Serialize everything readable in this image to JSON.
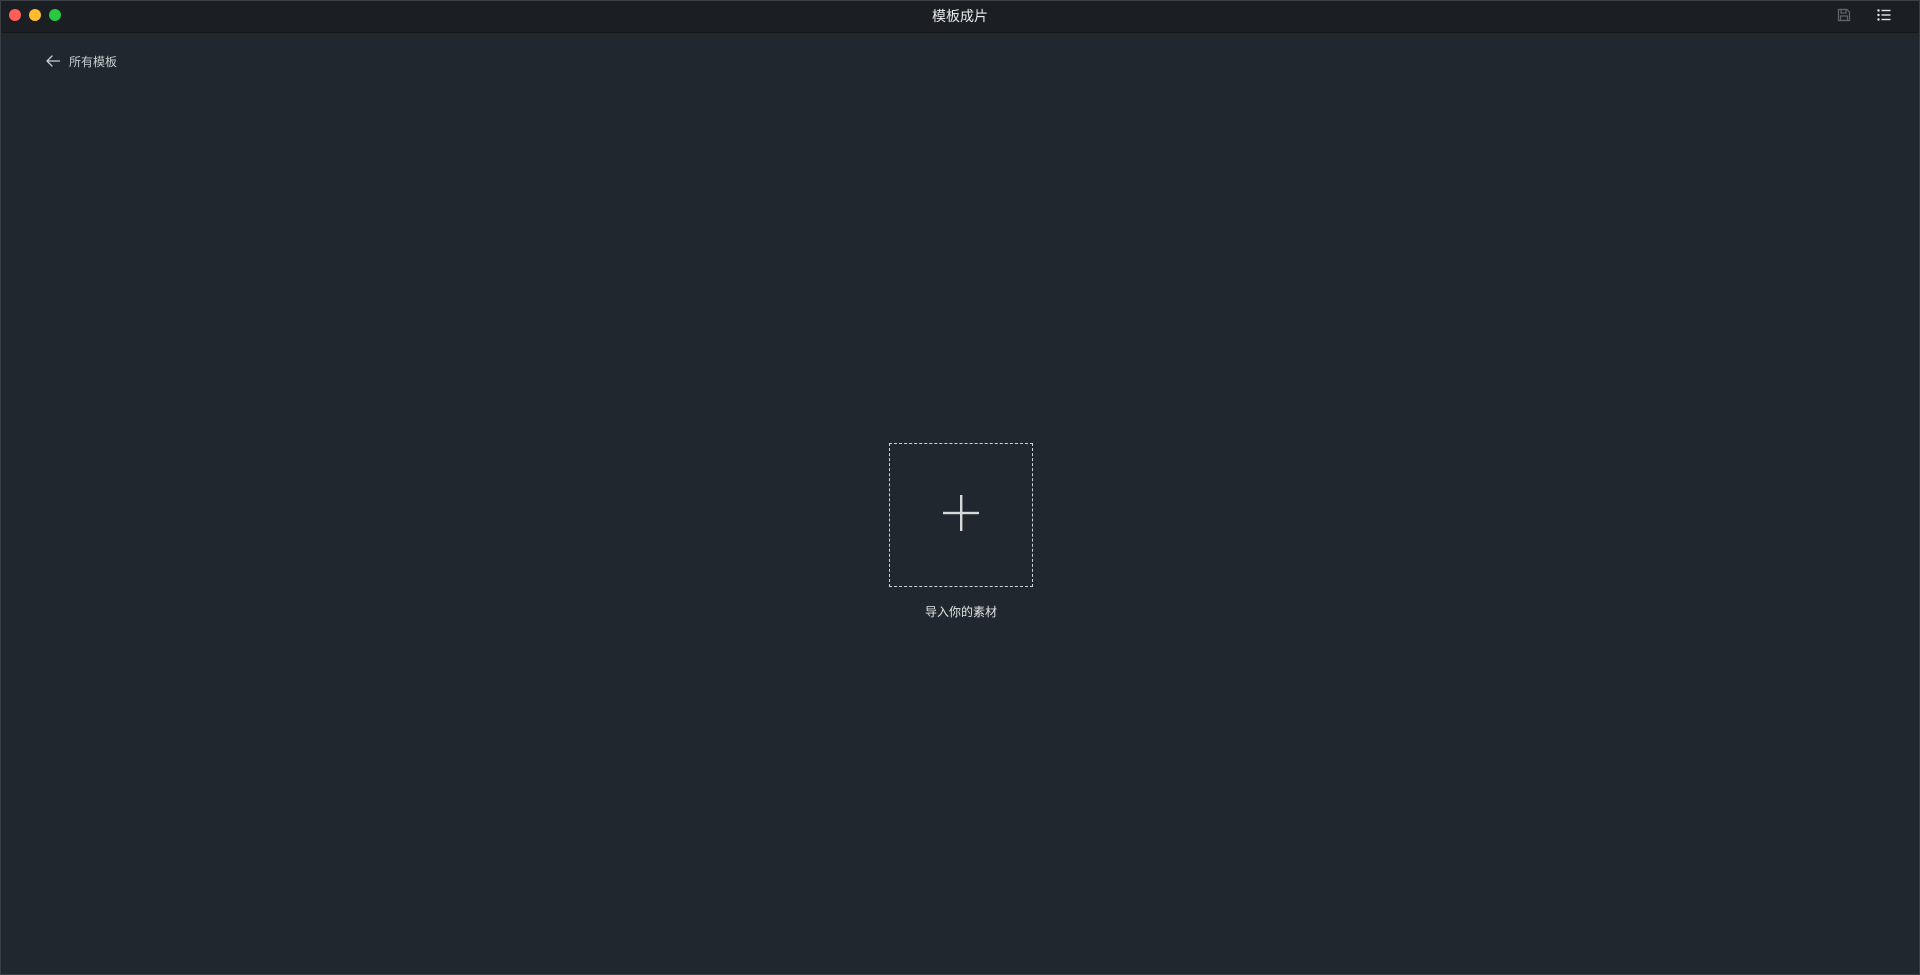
{
  "window": {
    "title": "模板成片"
  },
  "colors": {
    "background": "#21272e",
    "titlebar": "#1b1f23",
    "traffic_close": "#ff5f57",
    "traffic_minimize": "#febc2e",
    "traffic_maximize": "#28c840"
  },
  "header": {
    "back_label": "所有模板",
    "back_icon": "arrow-left-icon"
  },
  "toolbar": {
    "save_icon": "save-icon",
    "list_icon": "list-icon"
  },
  "main": {
    "import_icon": "plus-icon",
    "import_label": "导入你的素材"
  }
}
